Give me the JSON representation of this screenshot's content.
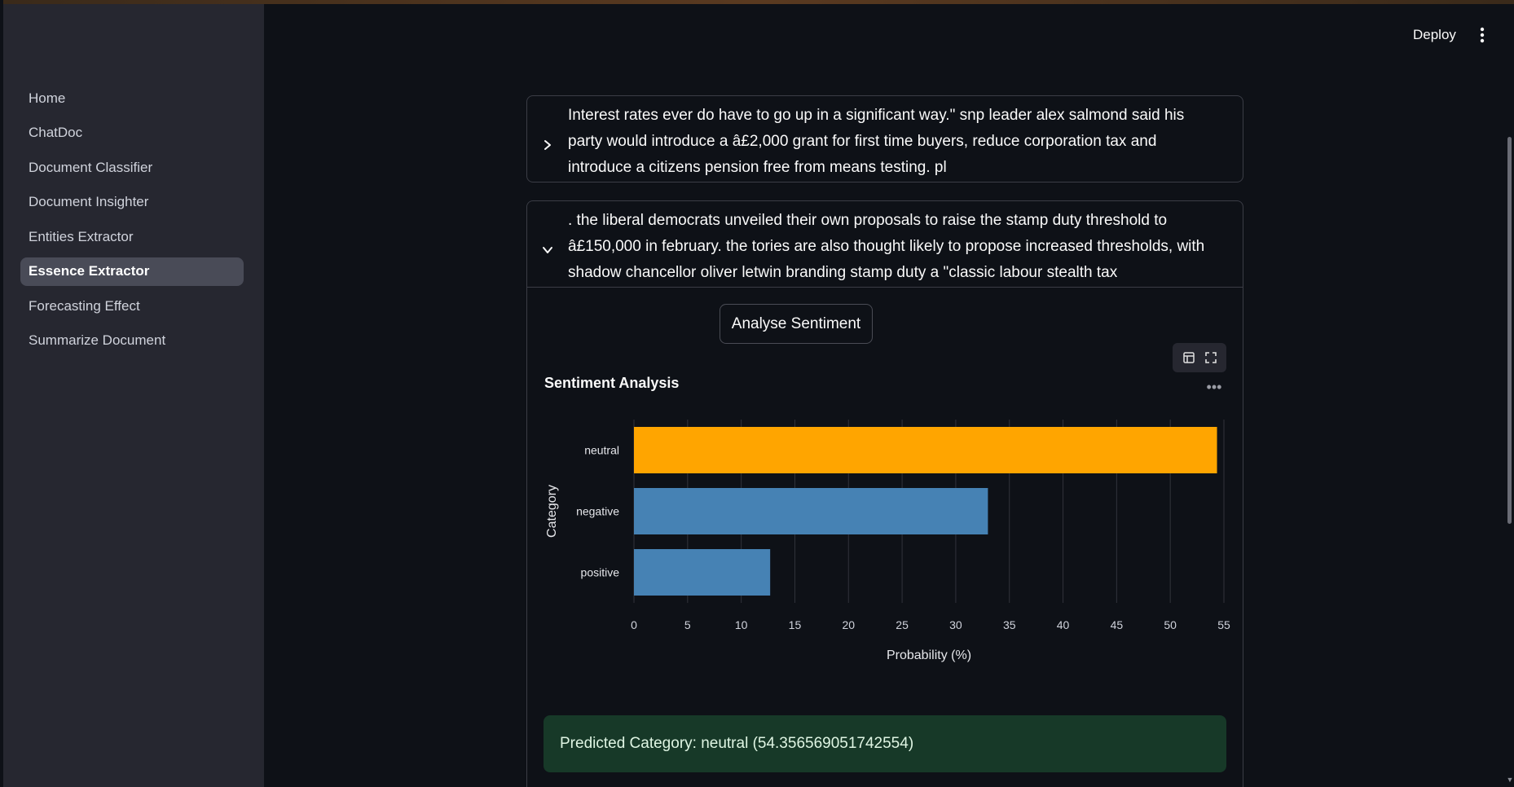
{
  "app": {
    "deploy_label": "Deploy"
  },
  "sidebar": {
    "items": [
      {
        "label": "Home"
      },
      {
        "label": "ChatDoc"
      },
      {
        "label": "Document Classifier"
      },
      {
        "label": "Document Insighter"
      },
      {
        "label": "Entities Extractor"
      },
      {
        "label": "Essence Extractor"
      },
      {
        "label": "Forecasting Effect"
      },
      {
        "label": "Summarize Document"
      }
    ],
    "active_index": 5
  },
  "expanders": [
    {
      "text": "Interest rates ever do have to go up in a significant way.\" snp leader alex salmond said his party would introduce a â£2,000 grant for first time buyers, reduce corporation tax and introduce a citizens pension free from means testing. pl",
      "expanded": false
    },
    {
      "text": ". the liberal democrats unveiled their own proposals to raise the stamp duty threshold to â£150,000 in february. the tories are also thought likely to propose increased thresholds, with shadow chancellor oliver letwin branding stamp duty a \"classic labour stealth tax",
      "expanded": true
    }
  ],
  "analyse_button": {
    "label": "Analyse Sentiment"
  },
  "chart_data": {
    "type": "bar",
    "orientation": "horizontal",
    "title": "Sentiment Analysis",
    "xlabel": "Probability (%)",
    "ylabel": "Category",
    "categories": [
      "neutral",
      "negative",
      "positive"
    ],
    "values": [
      54.356569051742554,
      33.0,
      12.7
    ],
    "colors": [
      "#ffa500",
      "#4682b4",
      "#4682b4"
    ],
    "xlim": [
      0,
      55
    ],
    "xticks": [
      0,
      5,
      10,
      15,
      20,
      25,
      30,
      35,
      40,
      45,
      50,
      55
    ],
    "grid": true
  },
  "result": {
    "text": "Predicted Category: neutral (54.356569051742554)"
  },
  "colors": {
    "background": "#0e1117",
    "sidebar": "#262730",
    "success_bg": "#173928",
    "highlight": "#ffa500",
    "bar": "#4682b4"
  }
}
